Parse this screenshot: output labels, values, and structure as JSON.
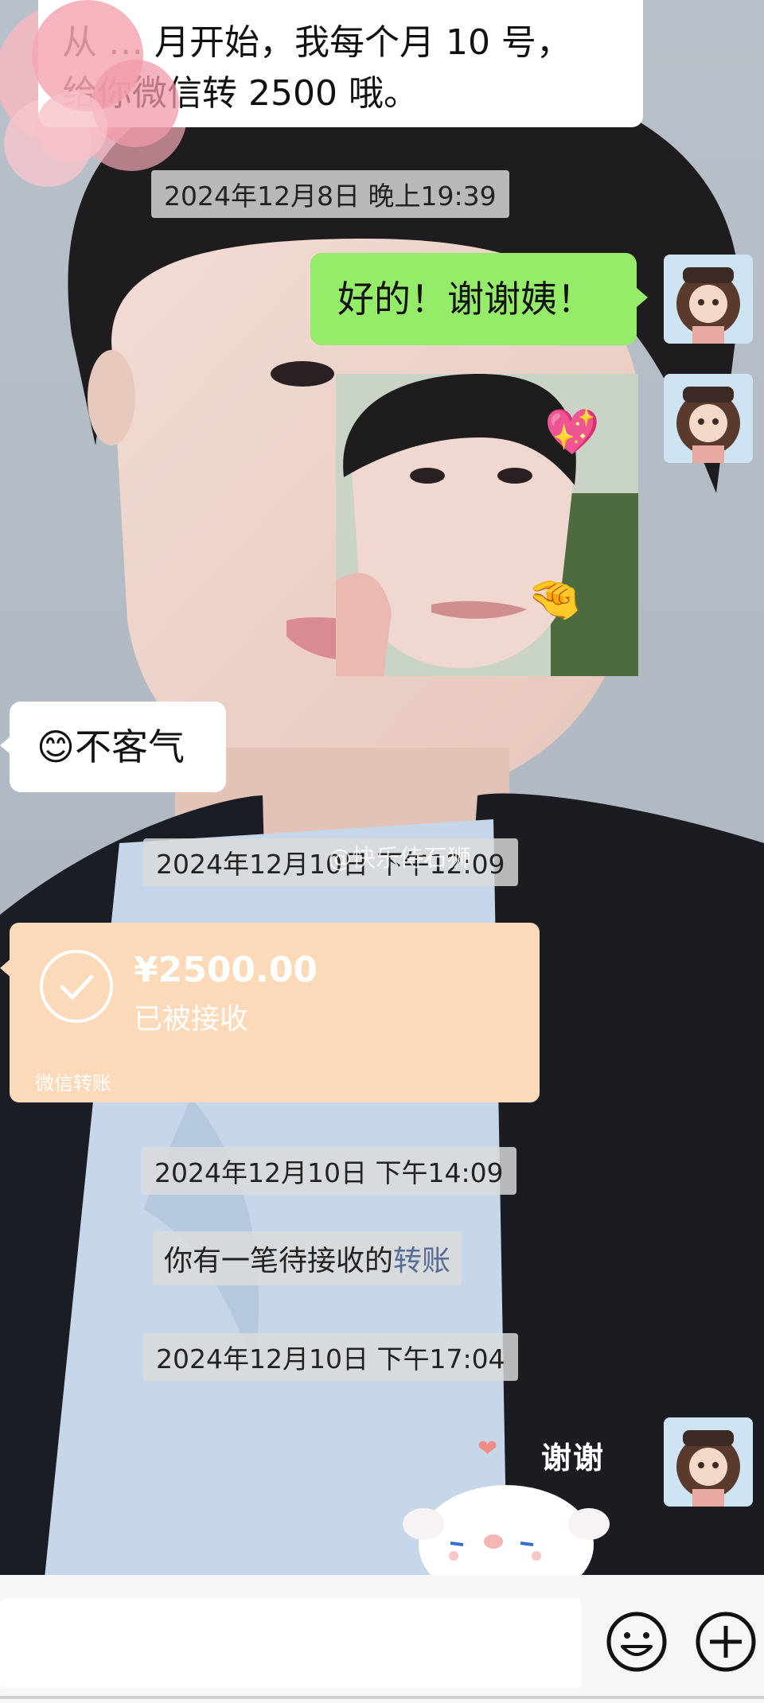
{
  "top_message": {
    "line1": "从 … 月开始，我每个月 10 号，",
    "line2": "给你微信转 2500 哦。"
  },
  "timestamps": [
    "2024年12月8日 晚上19:39",
    "2024年12月10日 下午12:09",
    "2024年12月10日 下午14:09",
    "2024年12月10日 下午17:04"
  ],
  "my_message_1": "好的！谢谢姨！",
  "their_reply": {
    "emoji": "😊",
    "text": "不客气"
  },
  "watermark": "@快乐侍石狮",
  "transfer": {
    "amount": "¥2500.00",
    "status": "已被接收",
    "footer": "微信转账"
  },
  "system_notice": {
    "prefix": "你有一笔待接收的",
    "link": "转账"
  },
  "sticker_text": "谢谢",
  "input_bar": {
    "emoji_icon": "emoji-icon",
    "plus_icon": "plus-icon"
  },
  "colors": {
    "my_bubble": "#95ec69",
    "transfer_card": "#fcd9b9",
    "link_blue": "#576b95"
  }
}
